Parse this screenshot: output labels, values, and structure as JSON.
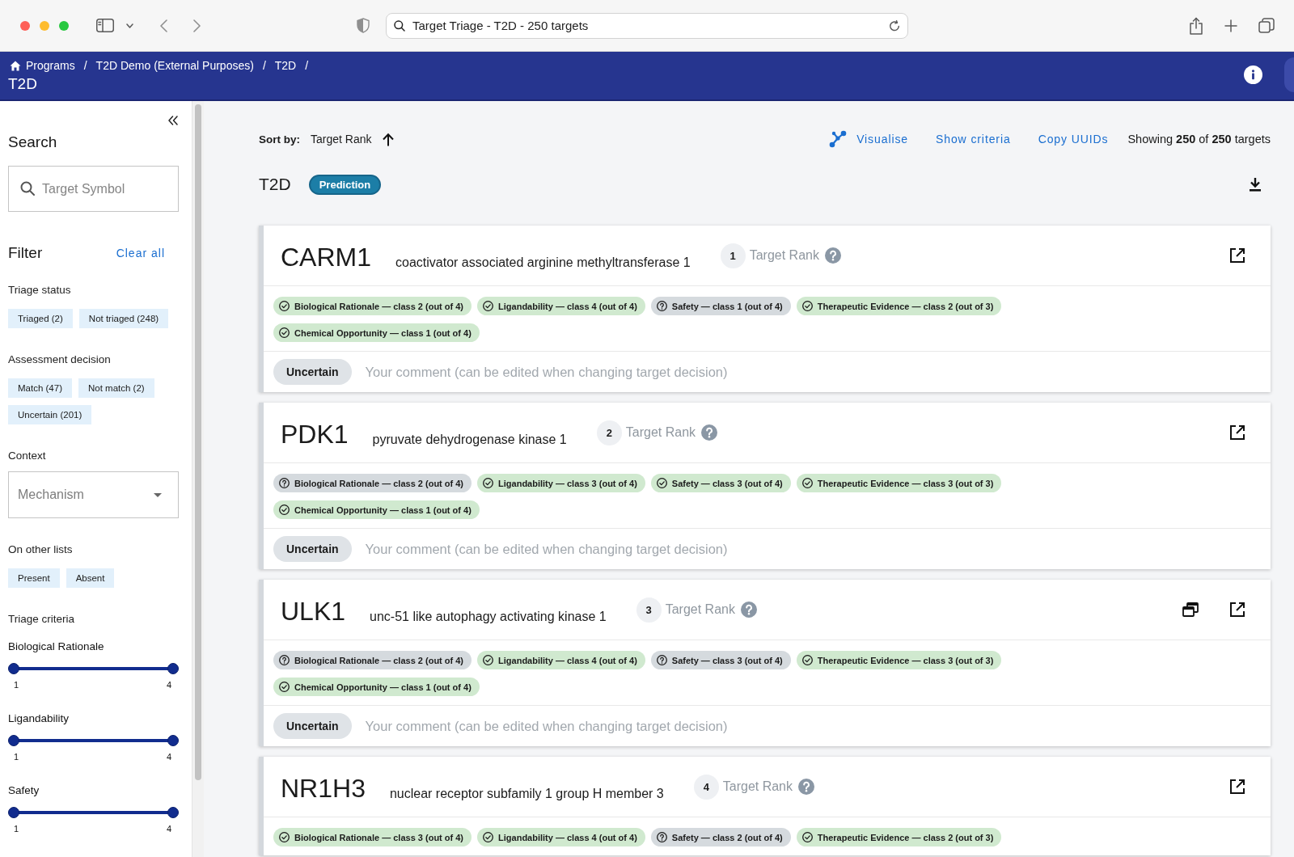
{
  "browser": {
    "address": "Target Triage - T2D - 250 targets"
  },
  "header": {
    "breadcrumbs": [
      {
        "label": "Programs",
        "separator": "/"
      },
      {
        "label": "T2D Demo (External Purposes)",
        "separator": "/"
      },
      {
        "label": "T2D",
        "separator": "/"
      }
    ],
    "title": "T2D"
  },
  "sidebar": {
    "search": {
      "title": "Search",
      "placeholder": "Target Symbol"
    },
    "filter": {
      "title": "Filter",
      "clear_label": "Clear all"
    },
    "sections": [
      {
        "kind": "chips",
        "title": "Triage status",
        "options": [
          {
            "label": "Triaged (2)",
            "selected": false
          },
          {
            "label": "Not triaged (248)",
            "selected": false
          }
        ]
      },
      {
        "kind": "chips",
        "title": "Assessment decision",
        "options": [
          {
            "label": "Match (47)",
            "selected": false
          },
          {
            "label": "Not match (2)",
            "selected": false
          },
          {
            "label": "Uncertain (201)",
            "selected": false
          }
        ]
      },
      {
        "kind": "select",
        "title": "Context",
        "placeholder": "Mechanism"
      },
      {
        "kind": "chips",
        "title": "On other lists",
        "options": [
          {
            "label": "Present",
            "selected": false
          },
          {
            "label": "Absent",
            "selected": false
          }
        ]
      },
      {
        "kind": "sliders",
        "title": "Triage criteria",
        "sliders": [
          {
            "label": "Biological Rationale",
            "min_label": "1",
            "max_label": "4",
            "thumbs": [
              {
                "level": 0
              },
              {
                "level": 1
              }
            ]
          },
          {
            "label": "Ligandability",
            "min_label": "1",
            "max_label": "4",
            "thumbs": [
              {
                "level": 0
              },
              {
                "level": 1
              }
            ]
          },
          {
            "label": "Safety",
            "min_label": "1",
            "max_label": "4",
            "thumbs": [
              {
                "level": 0
              },
              {
                "level": 1
              }
            ]
          }
        ]
      }
    ]
  },
  "toolbar": {
    "sort_label": "Sort by:",
    "sort_value": "Target Rank",
    "sort_ascending": true,
    "actions": [
      {
        "label": "Visualise",
        "has_icon": true
      },
      {
        "label": "Show criteria",
        "has_icon": false
      },
      {
        "label": "Copy UUIDs",
        "has_icon": false
      }
    ],
    "count": "Showing **250** of **250** targets"
  },
  "list": {
    "title": "T2D",
    "badge": "Prediction"
  },
  "targets": [
    {
      "symbol": "CARM1",
      "name": "coactivator associated arginine methyltransferase 1",
      "rank": "1",
      "rank_label": "Target Rank",
      "stack_icon": false,
      "criteria": [
        {
          "label": "Biological Rationale — class 2 (out of 4)",
          "met": true
        },
        {
          "label": "Ligandability — class 4 (out of 4)",
          "met": true
        },
        {
          "label": "Safety — class 1 (out of 4)",
          "met": false
        },
        {
          "label": "Therapeutic Evidence — class 2 (out of 3)",
          "met": true
        },
        {
          "label": "Chemical Opportunity — class 1 (out of 4)",
          "met": true
        }
      ],
      "decision": "Uncertain",
      "comment_placeholder": "Your comment (can be edited when changing target decision)"
    },
    {
      "symbol": "PDK1",
      "name": "pyruvate dehydrogenase kinase 1",
      "rank": "2",
      "rank_label": "Target Rank",
      "stack_icon": false,
      "criteria": [
        {
          "label": "Biological Rationale — class 2 (out of 4)",
          "met": false
        },
        {
          "label": "Ligandability — class 3 (out of 4)",
          "met": true
        },
        {
          "label": "Safety — class 3 (out of 4)",
          "met": true
        },
        {
          "label": "Therapeutic Evidence — class 3 (out of 3)",
          "met": true
        },
        {
          "label": "Chemical Opportunity — class 1 (out of 4)",
          "met": true
        }
      ],
      "decision": "Uncertain",
      "comment_placeholder": "Your comment (can be edited when changing target decision)"
    },
    {
      "symbol": "ULK1",
      "name": "unc-51 like autophagy activating kinase 1",
      "rank": "3",
      "rank_label": "Target Rank",
      "stack_icon": true,
      "criteria": [
        {
          "label": "Biological Rationale — class 2 (out of 4)",
          "met": false
        },
        {
          "label": "Ligandability — class 4 (out of 4)",
          "met": true
        },
        {
          "label": "Safety — class 3 (out of 4)",
          "met": false
        },
        {
          "label": "Therapeutic Evidence — class 3 (out of 3)",
          "met": true
        },
        {
          "label": "Chemical Opportunity — class 1 (out of 4)",
          "met": true
        }
      ],
      "decision": "Uncertain",
      "comment_placeholder": "Your comment (can be edited when changing target decision)"
    },
    {
      "symbol": "NR1H3",
      "name": "nuclear receptor subfamily 1 group H member 3",
      "rank": "4",
      "rank_label": "Target Rank",
      "stack_icon": false,
      "criteria": [
        {
          "label": "Biological Rationale — class 3 (out of 4)",
          "met": true
        },
        {
          "label": "Ligandability — class 4 (out of 4)",
          "met": true
        },
        {
          "label": "Safety — class 2 (out of 4)",
          "met": false
        },
        {
          "label": "Therapeutic Evidence — class 2 (out of 3)",
          "met": true
        }
      ]
    }
  ]
}
